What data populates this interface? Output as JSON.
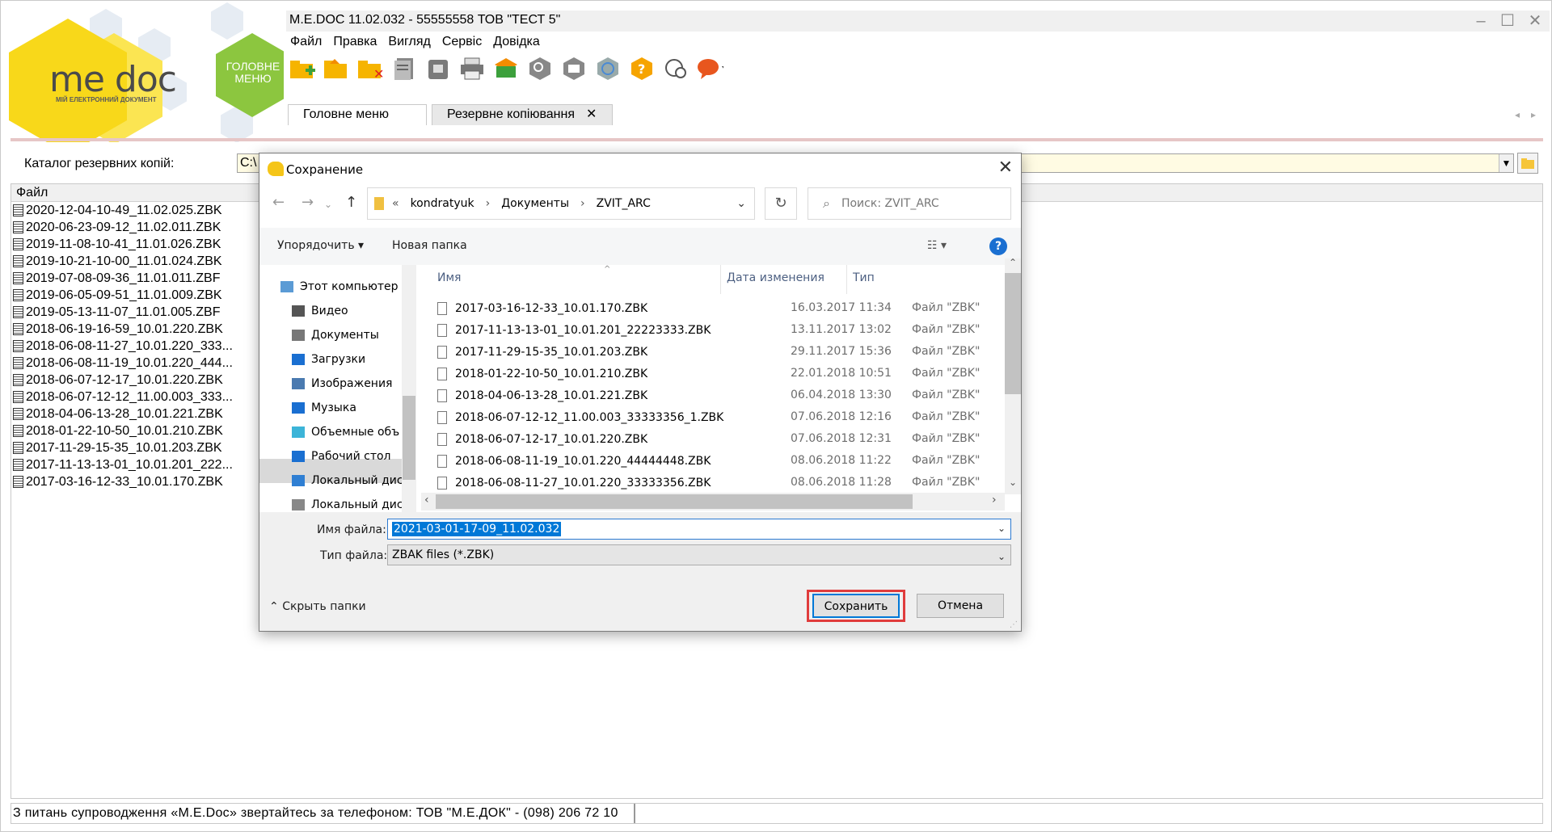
{
  "app": {
    "title": "M.E.DOC 11.02.032  -  55555558 ТОВ \"ТЕСТ 5\"",
    "logo_text": "me doc",
    "logo_subtitle": "МІЙ ЕЛЕКТРОННИЙ ДОКУМЕНТ",
    "main_menu_tile": "ГОЛОВНЕ МЕНЮ"
  },
  "menu": [
    "Файл",
    "Правка",
    "Вигляд",
    "Сервіс",
    "Довідка"
  ],
  "toolbar_icons": [
    "new-folder-icon",
    "open-folder-icon",
    "delete-folder-icon",
    "documents-icon",
    "archive-icon",
    "print-icon",
    "send-icon",
    "search-icon",
    "mail-icon",
    "verify-icon",
    "help-icon",
    "support-icon",
    "chat-icon"
  ],
  "tabs": [
    {
      "label": "Головне меню"
    },
    {
      "label": "Резервне копіювання",
      "close": "✕"
    }
  ],
  "catalog": {
    "label": "Каталог резервних копій:",
    "value": "C:\\"
  },
  "filelist": {
    "header": "Файл",
    "files": [
      "2020-12-04-10-49_11.02.025.ZBK",
      "2020-06-23-09-12_11.02.011.ZBK",
      "2019-11-08-10-41_11.01.026.ZBK",
      "2019-10-21-10-00_11.01.024.ZBK",
      "2019-07-08-09-36_11.01.011.ZBF",
      "2019-06-05-09-51_11.01.009.ZBK",
      "2019-05-13-11-07_11.01.005.ZBF",
      "2018-06-19-16-59_10.01.220.ZBK",
      "2018-06-08-11-27_10.01.220_333...",
      "2018-06-08-11-19_10.01.220_444...",
      "2018-06-07-12-17_10.01.220.ZBK",
      "2018-06-07-12-12_11.00.003_333...",
      "2018-04-06-13-28_10.01.221.ZBK",
      "2018-01-22-10-50_10.01.210.ZBK",
      "2017-11-29-15-35_10.01.203.ZBK",
      "2017-11-13-13-01_10.01.201_222...",
      "2017-03-16-12-33_10.01.170.ZBK"
    ]
  },
  "status": {
    "text": "З питань супроводження «M.E.Doc» звертайтесь за телефоном: ТОВ \"М.Е.ДОК\" - (098) 206 72 10"
  },
  "dialog": {
    "title": "Сохранение",
    "close": "✕",
    "breadcrumb": [
      "«",
      "kondratyuk",
      "›",
      "Документы",
      "›",
      "ZVIT_ARC"
    ],
    "search_placeholder": "Поиск: ZVIT_ARC",
    "organize": "Упорядочить ▾",
    "new_folder": "Новая папка",
    "help": "?",
    "nav": [
      {
        "label": "Этот компьютер",
        "icon": "computer-icon"
      },
      {
        "label": "Видео",
        "icon": "video-icon"
      },
      {
        "label": "Документы",
        "icon": "documents-icon"
      },
      {
        "label": "Загрузки",
        "icon": "downloads-icon"
      },
      {
        "label": "Изображения",
        "icon": "images-icon"
      },
      {
        "label": "Музыка",
        "icon": "music-icon"
      },
      {
        "label": "Объемные объ",
        "icon": "3d-objects-icon"
      },
      {
        "label": "Рабочий стол",
        "icon": "desktop-icon"
      },
      {
        "label": "Локальный дис",
        "icon": "local-disk-icon"
      },
      {
        "label": "Локальный дис",
        "icon": "local-disk-icon"
      }
    ],
    "columns": {
      "name": "Имя",
      "date": "Дата изменения",
      "type": "Тип"
    },
    "rows": [
      {
        "name": "2017-03-16-12-33_10.01.170.ZBK",
        "date": "16.03.2017 11:34",
        "type": "Файл \"ZBK\""
      },
      {
        "name": "2017-11-13-13-01_10.01.201_22223333.ZBK",
        "date": "13.11.2017 13:02",
        "type": "Файл \"ZBK\""
      },
      {
        "name": "2017-11-29-15-35_10.01.203.ZBK",
        "date": "29.11.2017 15:36",
        "type": "Файл \"ZBK\""
      },
      {
        "name": "2018-01-22-10-50_10.01.210.ZBK",
        "date": "22.01.2018 10:51",
        "type": "Файл \"ZBK\""
      },
      {
        "name": "2018-04-06-13-28_10.01.221.ZBK",
        "date": "06.04.2018 13:30",
        "type": "Файл \"ZBK\""
      },
      {
        "name": "2018-06-07-12-12_11.00.003_33333356_1.ZBK",
        "date": "07.06.2018 12:16",
        "type": "Файл \"ZBK\""
      },
      {
        "name": "2018-06-07-12-17_10.01.220.ZBK",
        "date": "07.06.2018 12:31",
        "type": "Файл \"ZBK\""
      },
      {
        "name": "2018-06-08-11-19_10.01.220_44444448.ZBK",
        "date": "08.06.2018 11:22",
        "type": "Файл \"ZBK\""
      },
      {
        "name": "2018-06-08-11-27_10.01.220_33333356.ZBK",
        "date": "08.06.2018 11:28",
        "type": "Файл \"ZBK\""
      }
    ],
    "filename_label": "Имя файла:",
    "filename_value": "2021-03-01-17-09_11.02.032",
    "filetype_label": "Тип файла:",
    "filetype_value": "ZBAK files (*.ZBK)",
    "hide_folders": "Скрыть папки",
    "save": "Сохранить",
    "cancel": "Отмена"
  },
  "colors": {
    "accent": "#0078d7",
    "highlight_frame": "#e03c3c",
    "logo_yellow": "#f8d81a",
    "menu_green": "#8cc63f"
  }
}
